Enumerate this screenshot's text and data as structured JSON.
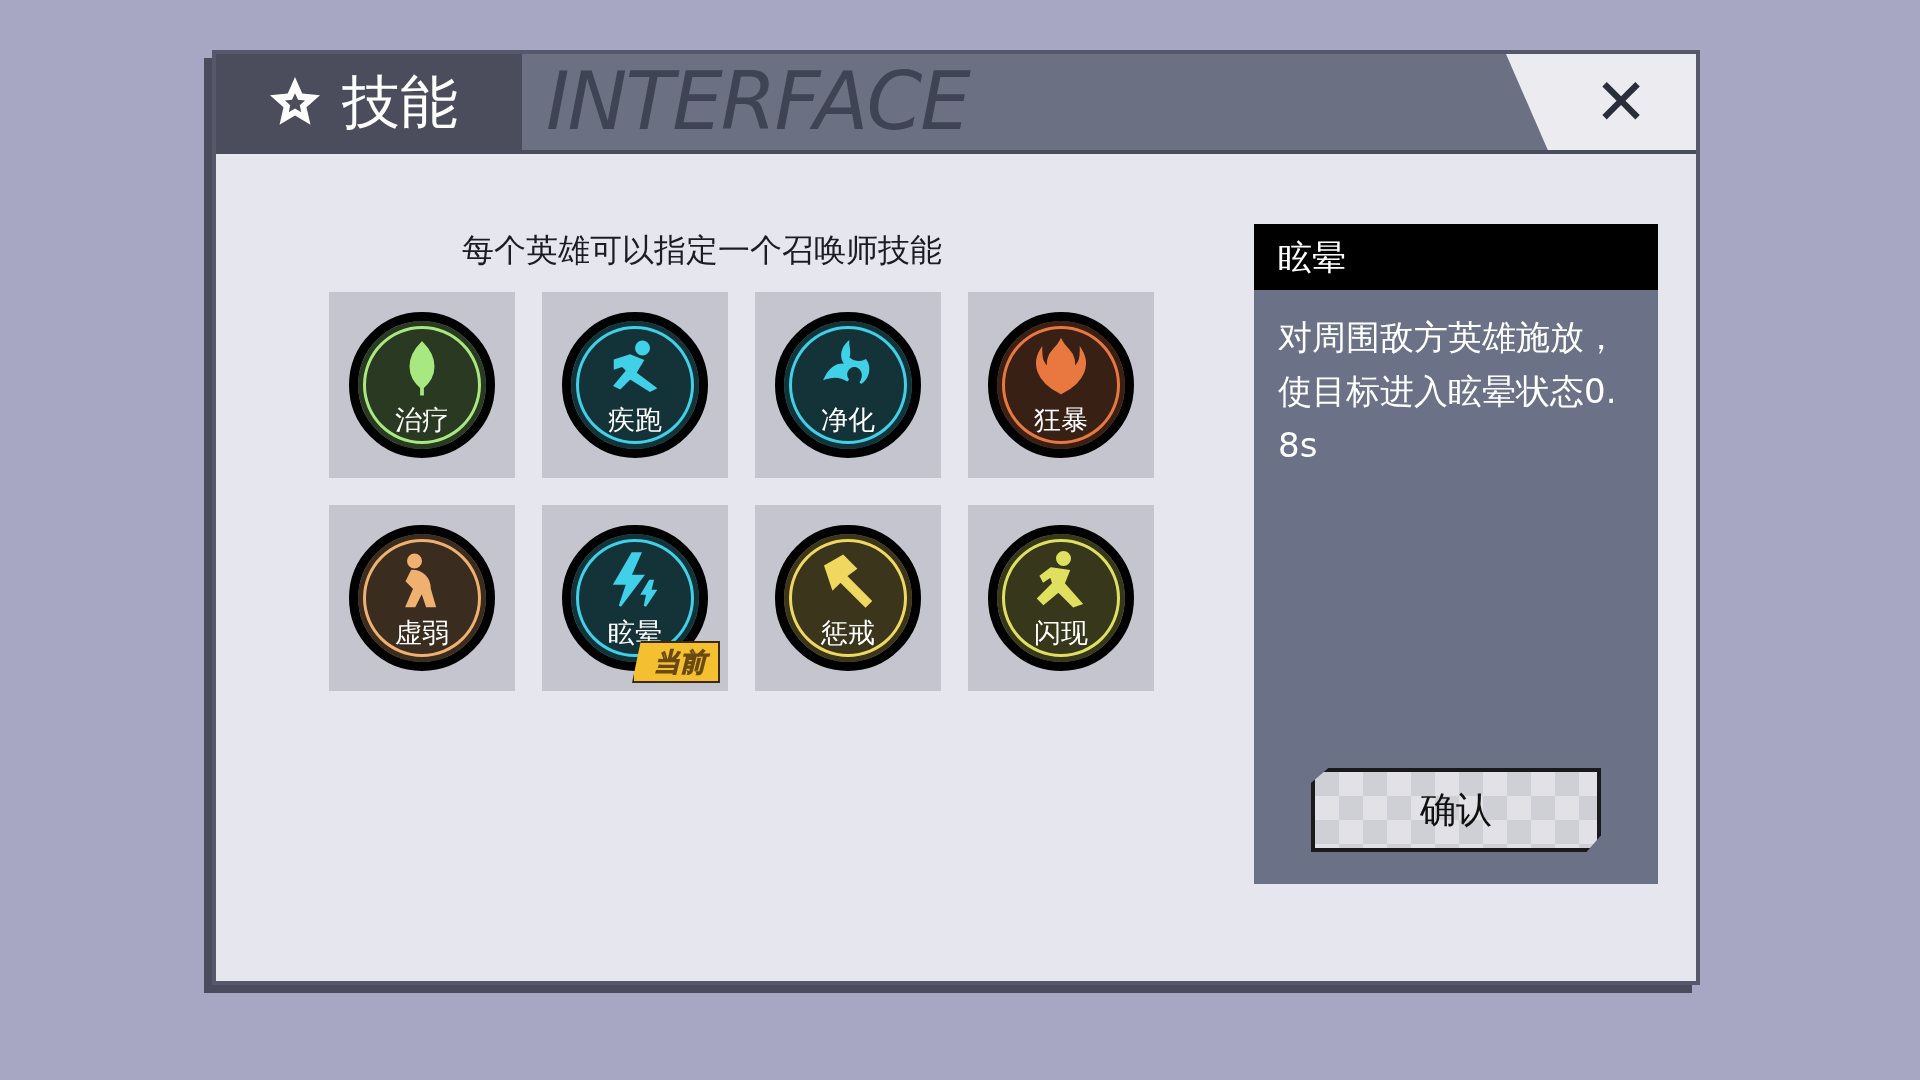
{
  "dialog": {
    "title": "技能",
    "header_decoration": "INTERFACE",
    "close": "✕"
  },
  "subtitle": "每个英雄可以指定一个召唤师技能",
  "current_badge": "当前",
  "skills": [
    {
      "name": "治疗",
      "color": "#a8e880",
      "current": false
    },
    {
      "name": "疾跑",
      "color": "#40d0e8",
      "current": false
    },
    {
      "name": "净化",
      "color": "#40d0e8",
      "current": false
    },
    {
      "name": "狂暴",
      "color": "#e87840",
      "current": false
    },
    {
      "name": "虚弱",
      "color": "#f0b070",
      "current": false
    },
    {
      "name": "眩晕",
      "color": "#40d0e8",
      "current": true
    },
    {
      "name": "惩戒",
      "color": "#f0d860",
      "current": false
    },
    {
      "name": "闪现",
      "color": "#e0e060",
      "current": false
    }
  ],
  "detail": {
    "title": "眩晕",
    "description": "对周围敌方英雄施放，使目标进入眩晕状态0.8s",
    "confirm": "确认"
  }
}
